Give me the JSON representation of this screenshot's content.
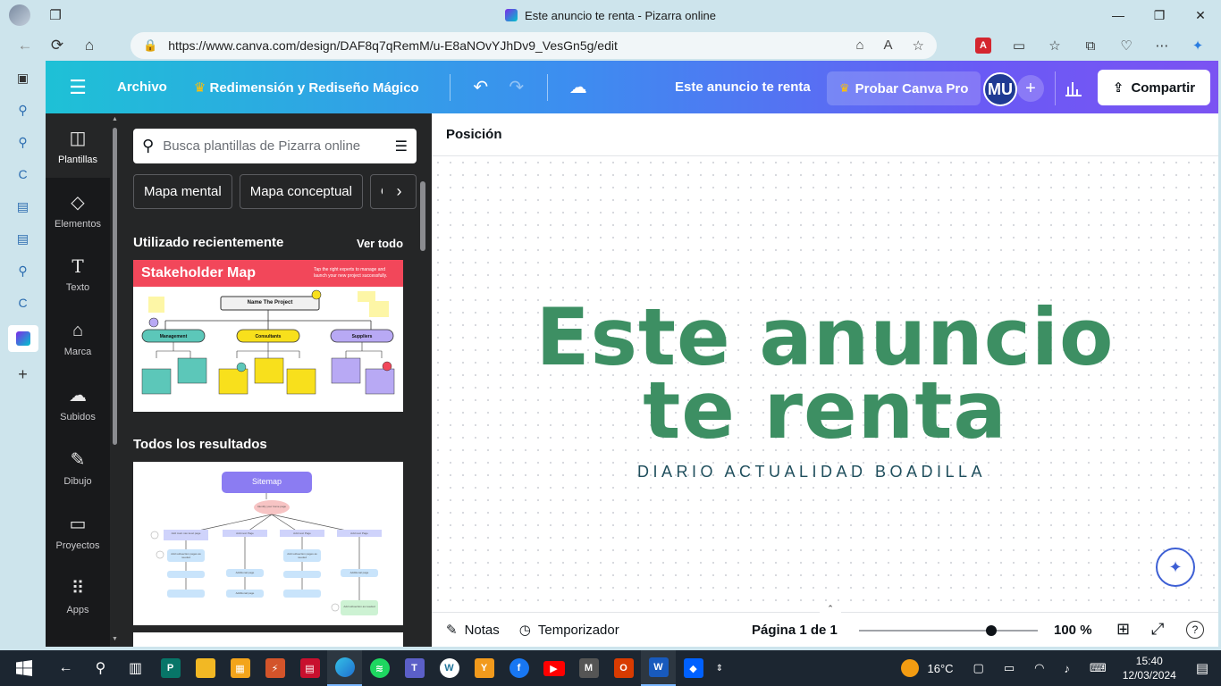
{
  "browser": {
    "tab_title": "Este anuncio te renta - Pizarra online",
    "url": "https://www.canva.com/design/DAF8q7qRemM/u-E8aNOvYJhDv9_VesGn5g/edit"
  },
  "header": {
    "file_label": "Archivo",
    "magic_label": "Redimensión y Rediseño Mágico",
    "doc_title": "Este anuncio te renta",
    "pro_label": "Probar Canva Pro",
    "avatar_initials": "MU",
    "share_label": "Compartir"
  },
  "nav": {
    "items": [
      {
        "label": "Plantillas",
        "icon": "template-icon"
      },
      {
        "label": "Elementos",
        "icon": "shapes-icon"
      },
      {
        "label": "Texto",
        "icon": "text-icon"
      },
      {
        "label": "Marca",
        "icon": "brand-icon"
      },
      {
        "label": "Subidos",
        "icon": "upload-cloud-icon"
      },
      {
        "label": "Dibujo",
        "icon": "draw-icon"
      },
      {
        "label": "Proyectos",
        "icon": "folder-icon"
      },
      {
        "label": "Apps",
        "icon": "apps-grid-icon"
      }
    ]
  },
  "panel": {
    "search_placeholder": "Busca plantillas de Pizarra online",
    "chips": [
      "Mapa mental",
      "Mapa conceptual",
      "Or"
    ],
    "recent_heading": "Utilizado recientemente",
    "see_all": "Ver todo",
    "results_heading": "Todos los resultados",
    "stakeholder": {
      "title": "Stakeholder Map",
      "tagline": "Tap the right experts to manage and launch your new project successfully.",
      "root": "Name The Project",
      "nodes": [
        "Management",
        "Consultants",
        "Suppliers"
      ]
    },
    "sitemap": {
      "title": "Sitemap",
      "root": "Identify your home page",
      "level1": [
        "Add main nav level page",
        "Add next Page",
        "Add next Page",
        "Add next Page"
      ],
      "level2": [
        "Add subsection pages as needed",
        "Additional page",
        "Add subsection pages as needed",
        "Additional page"
      ],
      "level3": "Additional page",
      "leaf": "Add subsection as needed"
    }
  },
  "canvas": {
    "toolbar_label": "Posición",
    "headline_line1": "Este anuncio",
    "headline_line2": "te renta",
    "subline": "DIARIO ACTUALIDAD BOADILLA"
  },
  "footer": {
    "notes": "Notas",
    "timer": "Temporizador",
    "page": "Página 1 de 1",
    "zoom": "100 %"
  },
  "taskbar": {
    "weather": "16°C",
    "time": "15:40",
    "date": "12/03/2024"
  },
  "colors": {
    "headline_green": "#3d8f63",
    "subline_teal": "#1f4e5c",
    "canva_panel_bg": "#252627",
    "stakeholder_red": "#f2475a"
  }
}
